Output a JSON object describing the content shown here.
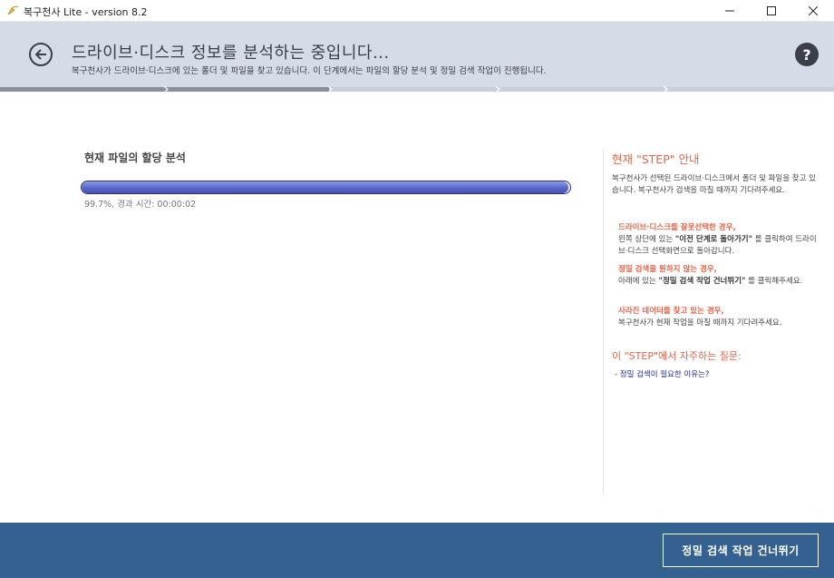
{
  "window": {
    "title": "복구천사 Lite - version 8.2"
  },
  "header": {
    "title": "드라이브·디스크 정보를 분석하는 중입니다...",
    "subtitle": "복구천사가 드라이브·디스크에 있는 폴더 및 파일을 찾고 있습니다. 이 단계에서는 파일의 할당 분석 및 정밀 검색 작업이 진행됩니다."
  },
  "steps": {
    "current_fraction": 0.395
  },
  "progress": {
    "label": "현재 파일의 할당 분석",
    "value_fraction": 0.997,
    "status": "99.7%, 경과 시간: 00:00:02"
  },
  "panel": {
    "title": "현재 \"STEP\" 안내",
    "intro": "복구천사가 선택된 드라이브·디스크에서 폴더 및 파일을 찾고 있습니다. 복구천사가 검색을 마칠 때까지 기다려주세요.",
    "tips": [
      {
        "head": "드라이브·디스크를 잘못선택한 경우,",
        "pre": "왼쪽 상단에 있는 ",
        "bold": "\"이전 단계로 돌아가기\"",
        "post": " 를 클릭하여 드라이브·디스크 선택화면으로 돌아갑니다."
      },
      {
        "head": "정밀 검색을 원하지 않는 경우,",
        "pre": "아래에 있는 ",
        "bold": "\"정밀 검색 작업 건너뛰기\"",
        "post": " 를 클릭해주세요."
      },
      {
        "head": "사라진 데이터를 찾고 있는 경우,",
        "pre": "복구천사가 현재 작업을 마칠 때까지 기다려주세요.",
        "bold": "",
        "post": ""
      }
    ],
    "faq_title": "이 \"STEP\"에서 자주하는 질문:",
    "faq_link": "- 정밀 검색이 필요한 이유는?"
  },
  "footer": {
    "skip_label": "정밀 검색 작업 건너뛰기"
  },
  "colors": {
    "header_bg": "#d6dbe8",
    "footer_bg": "#34618f",
    "accent": "#e0654a",
    "progress": "#5a67c9",
    "link": "#1b2a8c"
  }
}
